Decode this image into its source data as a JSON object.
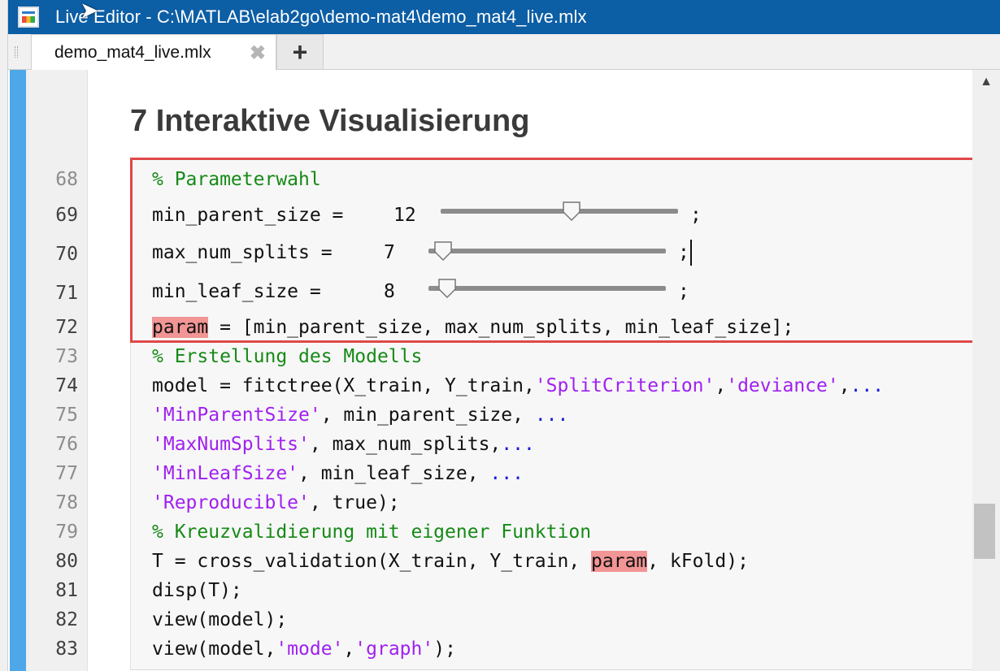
{
  "window": {
    "title": "Live Editor - C:\\MATLAB\\elab2go\\demo-mat4\\demo_mat4_live.mlx"
  },
  "tabs": [
    {
      "label": "demo_mat4_live.mlx",
      "close": "✖"
    }
  ],
  "new_tab_label": "+",
  "section_heading": "7 Interaktive Visualisierung",
  "line_numbers": [
    "68",
    "69",
    "70",
    "71",
    "72",
    "73",
    "74",
    "75",
    "76",
    "77",
    "78",
    "79",
    "80",
    "81",
    "82",
    "83"
  ],
  "sliders": [
    {
      "lhs": "min_parent_size =",
      "value": "12",
      "level": 0.55
    },
    {
      "lhs": "max_num_splits =",
      "value": "7",
      "level": 0.06
    },
    {
      "lhs": "min_leaf_size =",
      "value": "8",
      "level": 0.08
    }
  ],
  "code": {
    "l68": "% Parameterwahl",
    "semicolon": ";",
    "l72_var": "param",
    "l72_rest": " = [min_parent_size, max_num_splits, min_leaf_size];",
    "l73": "% Erstellung des Modells",
    "l74_a": "model = fitctree(X_train, Y_train,",
    "l74_s1": "'SplitCriterion'",
    "l74_b": ",",
    "l74_s2": "'deviance'",
    "l74_c": ",",
    "l74_e": "...",
    "l75_s": "'MinParentSize'",
    "l75_b": ", min_parent_size, ",
    "l75_e": "...",
    "l76_s": "'MaxNumSplits'",
    "l76_b": ", max_num_splits,",
    "l76_e": "...",
    "l77_s": "'MinLeafSize'",
    "l77_b": ", min_leaf_size, ",
    "l77_e": "...",
    "l78_s": "'Reproducible'",
    "l78_b": ", true);",
    "l79": "% Kreuzvalidierung mit eigener Funktion",
    "l80_a": "T = cross_validation(X_train, Y_train, ",
    "l80_hl": "param",
    "l80_b": ", kFold);",
    "l81": "disp(T);",
    "l82": "view(model);",
    "l83_a": "view(model,",
    "l83_s1": "'mode'",
    "l83_b": ",",
    "l83_s2": "'graph'",
    "l83_c": ");"
  },
  "colors": {
    "titlebar": "#0c5ea5",
    "comment": "#168a16",
    "string": "#a020f0",
    "ellipsis": "#1a1ad8",
    "highlight": "#f29595",
    "annotation_box": "#e04848"
  },
  "icons": {
    "app": "live-editor-app-icon",
    "tab_close": "close-icon",
    "scroll_up": "scroll-up-arrow-icon"
  }
}
